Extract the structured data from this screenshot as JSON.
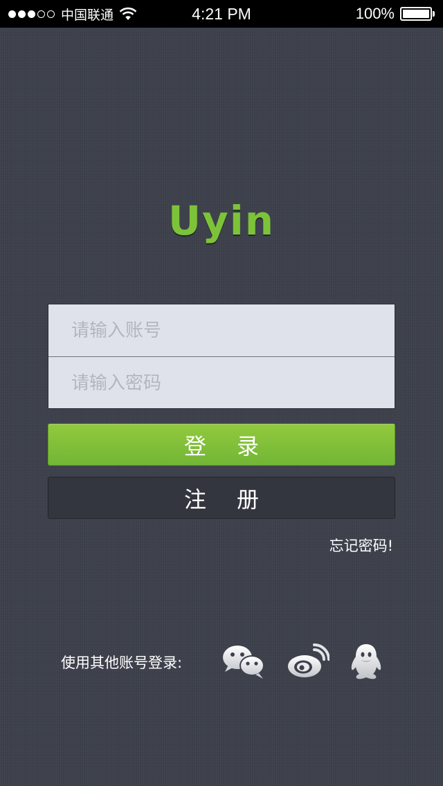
{
  "status_bar": {
    "signal_dots": [
      "filled",
      "filled",
      "filled",
      "empty",
      "empty"
    ],
    "carrier": "中国联通",
    "wifi_icon": "wifi-icon",
    "time": "4:21 PM",
    "battery_percent": "100%",
    "battery_icon": "battery-full-icon"
  },
  "logo": {
    "text": "Uyin",
    "color": "#7dc33a"
  },
  "form": {
    "account_placeholder": "请输入账号",
    "account_value": "",
    "password_placeholder": "请输入密码",
    "password_value": ""
  },
  "buttons": {
    "login_label": "登录",
    "login_color": "#80bd38",
    "register_label": "注册",
    "register_color": "#33363f"
  },
  "forgot_password": "忘记密码!",
  "other_login": {
    "label": "使用其他账号登录:",
    "providers": [
      {
        "name": "wechat",
        "icon": "wechat-icon"
      },
      {
        "name": "weibo",
        "icon": "weibo-icon"
      },
      {
        "name": "qq",
        "icon": "qq-icon"
      }
    ]
  },
  "colors": {
    "background": "#3d414c",
    "input_background": "#dfe2eb",
    "placeholder": "#b3b6bd"
  }
}
